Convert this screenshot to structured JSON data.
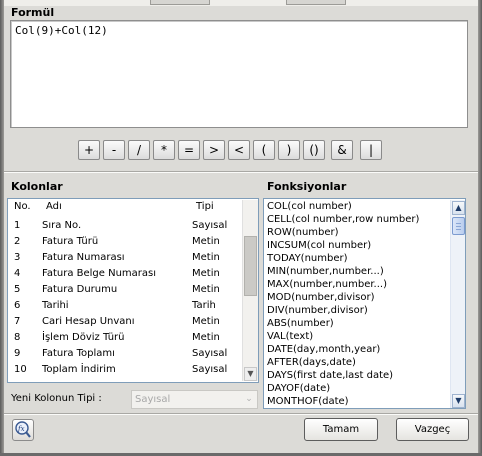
{
  "formula": {
    "title": "Formül",
    "expression": "Col(9)+Col(12)"
  },
  "operators": [
    "+",
    "-",
    "/",
    "*",
    "=",
    ">",
    "<",
    "(",
    ")",
    "()",
    "&",
    "|"
  ],
  "columns": {
    "title": "Kolonlar",
    "headers": {
      "no": "No.",
      "name": "Adı",
      "type": "Tipi"
    },
    "rows": [
      {
        "no": "1",
        "name": "Sıra No.",
        "type": "Sayısal"
      },
      {
        "no": "2",
        "name": "Fatura Türü",
        "type": "Metin"
      },
      {
        "no": "3",
        "name": "Fatura Numarası",
        "type": "Metin"
      },
      {
        "no": "4",
        "name": "Fatura Belge Numarası",
        "type": "Metin"
      },
      {
        "no": "5",
        "name": "Fatura Durumu",
        "type": "Metin"
      },
      {
        "no": "6",
        "name": "Tarihi",
        "type": "Tarih"
      },
      {
        "no": "7",
        "name": "Cari Hesap Unvanı",
        "type": "Metin"
      },
      {
        "no": "8",
        "name": "İşlem Döviz Türü",
        "type": "Metin"
      },
      {
        "no": "9",
        "name": "Fatura Toplamı",
        "type": "Sayısal"
      },
      {
        "no": "10",
        "name": "Toplam İndirim",
        "type": "Sayısal"
      }
    ],
    "new_type_label": "Yeni Kolonun Tipi :",
    "new_type_value": "Sayısal"
  },
  "functions": {
    "title": "Fonksiyonlar",
    "items": [
      "COL(col number)",
      "CELL(col number,row number)",
      "ROW(number)",
      "INCSUM(col number)",
      "TODAY(number)",
      "MIN(number,number...)",
      "MAX(number,number...)",
      "MOD(number,divisor)",
      "DIV(number,divisor)",
      "ABS(number)",
      "VAL(text)",
      "DATE(day,month,year)",
      "AFTER(days,date)",
      "DAYS(first date,last date)",
      "DAYOF(date)",
      "MONTHOF(date)"
    ]
  },
  "buttons": {
    "ok": "Tamam",
    "cancel": "Vazgeç"
  },
  "icons": {
    "formula_wizard": "fx-magnifier-icon",
    "scroll_up": "chevron-up-icon",
    "scroll_down": "chevron-down-icon",
    "combo_arrow": "chevron-down-icon"
  },
  "colors": {
    "dialog_bg": "#dcdbd7",
    "list_border": "#7f9db9",
    "scroll_accent": "#7c9bd0"
  }
}
